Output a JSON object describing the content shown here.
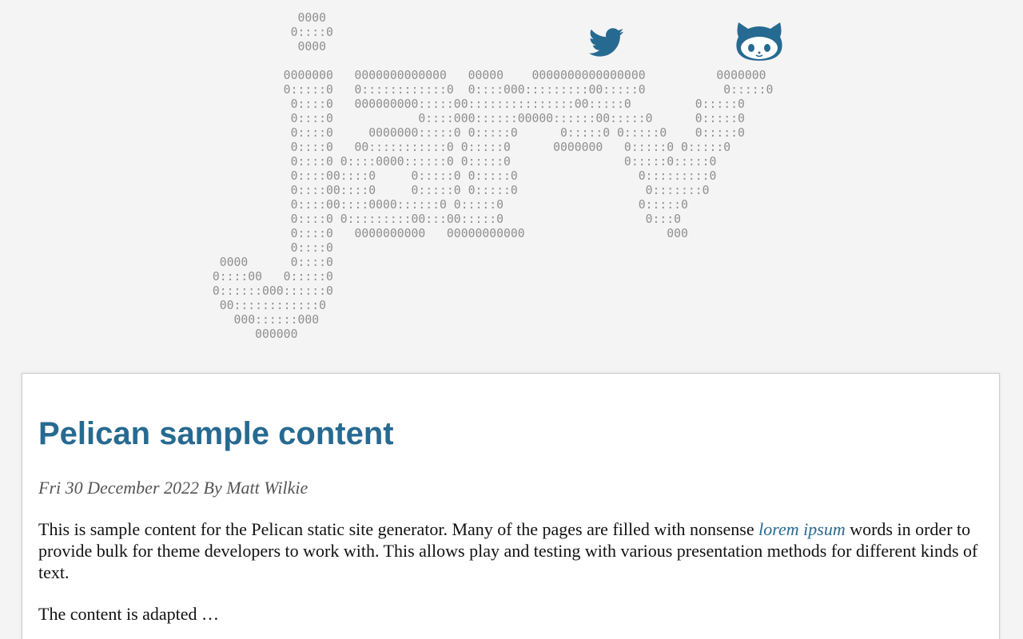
{
  "header": {
    "ascii_logo": "             0000\n            0::::0\n             0000\n\n           0000000   0000000000000   00000    0000000000000000          0000000\n           0:::::0   0::::::::::::0  0::::000:::::::::00:::::0           0:::::0\n            0::::0   000000000:::::00:::::::::::::::00:::::0         0:::::0\n            0::::0            0::::000::::::00000::::::00:::::0      0:::::0\n            0::::0     0000000:::::0 0:::::0      0:::::0 0:::::0    0:::::0\n            0::::0   00:::::::::::0 0:::::0      0000000   0:::::0 0:::::0\n            0::::0 0::::0000::::::0 0:::::0                0:::::0:::::0\n            0::::00::::0     0:::::0 0:::::0                 0:::::::::0\n            0::::00::::0     0:::::0 0:::::0                  0:::::::0\n            0::::00::::0000::::::0 0:::::0                   0:::::0\n            0::::0 0:::::::::00:::00:::::0                    0:::0\n            0::::0   0000000000   00000000000                    000\n            0::::0\n  0000      0::::0\n 0::::00   0:::::0\n 0::::::000::::::0\n  00::::::::::::0\n    000::::::000\n       000000",
    "social": [
      {
        "name": "twitter",
        "icon": "twitter-bird-icon",
        "color": "#276a91"
      },
      {
        "name": "github",
        "icon": "github-octocat-icon",
        "color": "#276a91"
      }
    ]
  },
  "article": {
    "title": "Pelican sample content",
    "meta": "Fri 30 December 2022 By Matt Wilkie",
    "body_before": "This is sample content for the Pelican static site generator. Many of the pages are filled with nonsense ",
    "link_text": "lorem ipsum",
    "body_after": " words in order to provide bulk for theme developers to work with. This allows play and testing with various presentation methods for different kinds of text.",
    "continued": "The content is adapted …"
  },
  "colors": {
    "background": "#f4f4f4",
    "accent": "#276a91",
    "ascii": "#8f8f8f"
  }
}
